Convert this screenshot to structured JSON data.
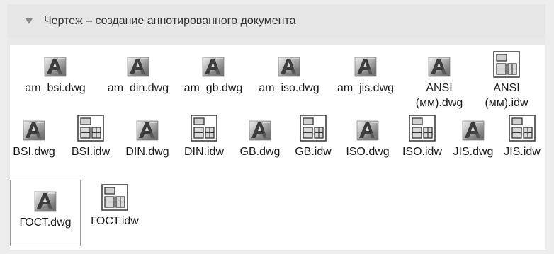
{
  "section": {
    "title": "Чертеж – создание аннотированного документа"
  },
  "files": [
    {
      "name": "am_bsi.dwg",
      "type": "dwg"
    },
    {
      "name": "am_din.dwg",
      "type": "dwg"
    },
    {
      "name": "am_gb.dwg",
      "type": "dwg"
    },
    {
      "name": "am_iso.dwg",
      "type": "dwg"
    },
    {
      "name": "am_jis.dwg",
      "type": "dwg"
    },
    {
      "name_line1": "ANSI",
      "name_line2": "(мм).dwg",
      "type": "dwg"
    },
    {
      "name_line1": "ANSI",
      "name_line2": "(мм).idw",
      "type": "idw"
    },
    {
      "name": "BSI.dwg",
      "type": "dwg"
    },
    {
      "name": "BSI.idw",
      "type": "idw"
    },
    {
      "name": "DIN.dwg",
      "type": "dwg"
    },
    {
      "name": "DIN.idw",
      "type": "idw"
    },
    {
      "name": "GB.dwg",
      "type": "dwg"
    },
    {
      "name": "GB.idw",
      "type": "idw"
    },
    {
      "name": "ISO.dwg",
      "type": "dwg"
    },
    {
      "name": "ISO.idw",
      "type": "idw"
    },
    {
      "name": "JIS.dwg",
      "type": "dwg"
    },
    {
      "name": "JIS.idw",
      "type": "idw"
    },
    {
      "name": "ГОСТ.dwg",
      "type": "dwg",
      "selected": true
    },
    {
      "name": "ГОСТ.idw",
      "type": "idw"
    }
  ]
}
